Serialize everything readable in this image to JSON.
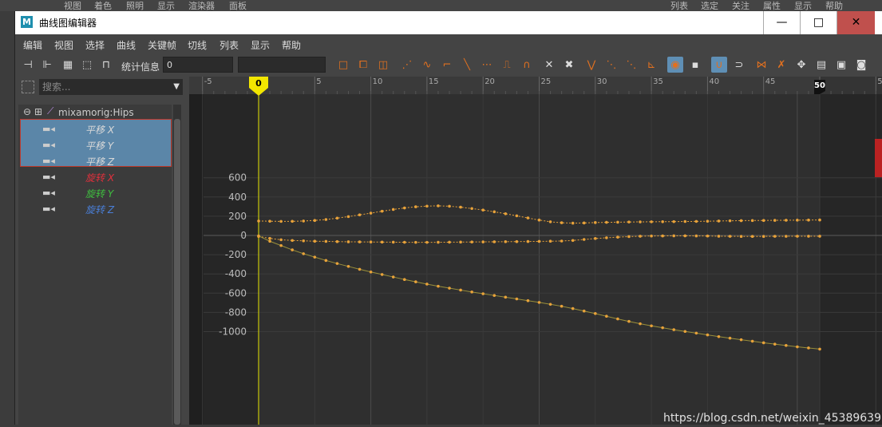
{
  "background_menu": [
    "视图",
    "着色",
    "照明",
    "显示",
    "渲染器",
    "面板",
    "列表",
    "选定",
    "关注",
    "属性",
    "显示",
    "帮助"
  ],
  "window": {
    "logo": "M",
    "title": "曲线图编辑器",
    "min": "—",
    "max": "□",
    "close": "✕"
  },
  "menubar": [
    "编辑",
    "视图",
    "选择",
    "曲线",
    "关键帧",
    "切线",
    "列表",
    "显示",
    "帮助"
  ],
  "toolbar": {
    "stats_label": "统计信息",
    "stats_value": "0",
    "stats_value2": ""
  },
  "outliner": {
    "search_placeholder": "搜索...",
    "node": {
      "expand": "⊖",
      "plus": "⊞",
      "name": "mixamorig:Hips"
    },
    "attributes": [
      {
        "label": "平移 X",
        "color": "#d8d8d8",
        "selected": true
      },
      {
        "label": "平移 Y",
        "color": "#d8d8d8",
        "selected": true
      },
      {
        "label": "平移 Z",
        "color": "#d8d8d8",
        "selected": true
      },
      {
        "label": "旋转 X",
        "color": "#e0303c",
        "selected": false
      },
      {
        "label": "旋转 Y",
        "color": "#3fbf3f",
        "selected": false
      },
      {
        "label": "旋转 Z",
        "color": "#4a7fd8",
        "selected": false
      }
    ]
  },
  "chart_data": {
    "type": "line",
    "x_ticks": [
      "-5",
      "0",
      "5",
      "10",
      "15",
      "20",
      "25",
      "30",
      "35",
      "40",
      "45",
      "50",
      "5"
    ],
    "y_ticks": [
      "600",
      "400",
      "200",
      "0",
      "-200",
      "-400",
      "-600",
      "-800",
      "-1000"
    ],
    "xlim": [
      -5,
      56
    ],
    "ylim": [
      -1000,
      650
    ],
    "current_frame": "0",
    "end_frame": "50",
    "series": [
      {
        "color": "#e8a23a",
        "x": [
          0,
          1,
          2,
          3,
          4,
          5,
          6,
          7,
          8,
          9,
          10,
          11,
          12,
          13,
          14,
          15,
          16,
          17,
          18,
          19,
          20,
          21,
          22,
          23,
          24,
          25,
          26,
          27,
          28,
          29,
          30,
          31,
          32,
          33,
          34,
          35,
          36,
          37,
          38,
          39,
          40,
          41,
          42,
          43,
          44,
          45,
          46,
          47,
          48,
          49,
          50
        ],
        "y": [
          150,
          148,
          146,
          147,
          150,
          156,
          166,
          180,
          196,
          214,
          232,
          252,
          270,
          286,
          298,
          305,
          308,
          304,
          294,
          280,
          264,
          246,
          226,
          204,
          182,
          160,
          142,
          132,
          128,
          130,
          134,
          136,
          138,
          140,
          141,
          142,
          143,
          144,
          145,
          146,
          148,
          150,
          152,
          154,
          155,
          156,
          157,
          158,
          159,
          160,
          161
        ]
      },
      {
        "color": "#e8a23a",
        "x": [
          0,
          1,
          2,
          3,
          4,
          5,
          6,
          7,
          8,
          9,
          10,
          11,
          12,
          13,
          14,
          15,
          16,
          17,
          18,
          19,
          20,
          21,
          22,
          23,
          24,
          25,
          26,
          27,
          28,
          29,
          30,
          31,
          32,
          33,
          34,
          35,
          36,
          37,
          38,
          39,
          40,
          41,
          42,
          43,
          44,
          45,
          46,
          47,
          48,
          49,
          50
        ],
        "y": [
          -10,
          -30,
          -45,
          -52,
          -56,
          -60,
          -62,
          -64,
          -66,
          -67,
          -68,
          -69,
          -70,
          -71,
          -72,
          -72,
          -71,
          -70,
          -69,
          -68,
          -67,
          -66,
          -65,
          -64,
          -63,
          -62,
          -60,
          -58,
          -52,
          -42,
          -32,
          -24,
          -18,
          -12,
          -8,
          -6,
          -5,
          -4,
          -4,
          -5,
          -6,
          -8,
          -9,
          -10,
          -10,
          -10,
          -9,
          -9,
          -8,
          -8,
          -8
        ]
      },
      {
        "color": "#e8a23a",
        "x": [
          0,
          1,
          2,
          3,
          4,
          5,
          6,
          7,
          8,
          9,
          10,
          11,
          12,
          13,
          14,
          15,
          16,
          17,
          18,
          19,
          20,
          21,
          22,
          23,
          24,
          25,
          26,
          27,
          28,
          29,
          30,
          31,
          32,
          33,
          34,
          35,
          36,
          37,
          38,
          39,
          40,
          41,
          42,
          43,
          44,
          45,
          46,
          47,
          48,
          49,
          50
        ],
        "y": [
          -5,
          -60,
          -105,
          -150,
          -190,
          -225,
          -260,
          -292,
          -322,
          -352,
          -380,
          -406,
          -432,
          -458,
          -482,
          -506,
          -528,
          -548,
          -568,
          -588,
          -606,
          -624,
          -642,
          -660,
          -678,
          -696,
          -716,
          -736,
          -760,
          -786,
          -812,
          -840,
          -868,
          -894,
          -918,
          -940,
          -960,
          -980,
          -998,
          -1016,
          -1034,
          -1052,
          -1068,
          -1084,
          -1100,
          -1116,
          -1130,
          -1144,
          -1158,
          -1170,
          -1182
        ]
      }
    ]
  },
  "watermark": "https://blog.csdn.net/weixin_45389639"
}
